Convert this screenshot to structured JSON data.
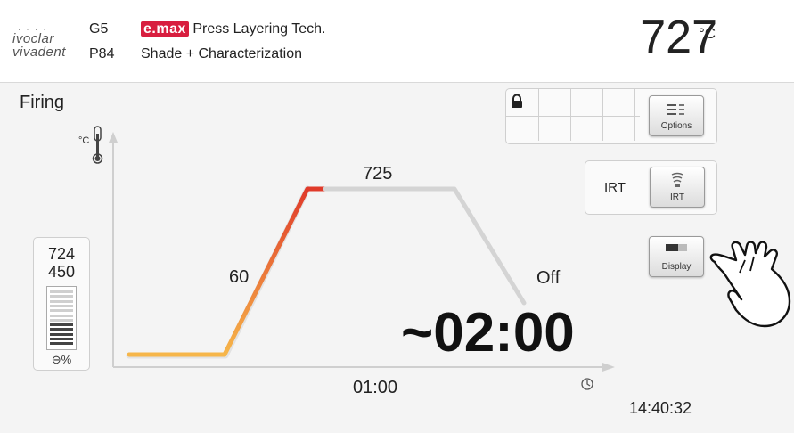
{
  "header": {
    "logo_top": "ivoclar",
    "logo_bottom": "vivadent",
    "program_code": "G5",
    "program_number": "P84",
    "brand": "e.max",
    "product_name": "Press Layering Tech.",
    "subtitle": "Shade + Characterization",
    "temperature": "727",
    "temperature_unit": "°C"
  },
  "main": {
    "title": "Firing",
    "axis_unit": "°C"
  },
  "gauge": {
    "top_value": "724",
    "bottom_value": "450",
    "footer": "%",
    "fill_fraction": 0.45
  },
  "toolbar": {
    "options_label": "Options",
    "irt_caption": "IRT",
    "irt_label": "IRT",
    "display_label": "Display"
  },
  "program_chart": {
    "rate_label": "60",
    "hold_temp_label": "725",
    "end_label": "Off",
    "hold_time_label": "01:00",
    "remaining_time": "~02:00"
  },
  "status": {
    "clock": "14:40:32"
  },
  "icons": {
    "lock": "lock-icon",
    "thermometer": "thermometer-icon",
    "timer": "clock-icon",
    "vacuum": "vacuum-icon",
    "options": "options-icon",
    "irt": "irt-sensor-icon",
    "display": "display-icon",
    "hand": "pointing-hand-icon"
  },
  "colors": {
    "brand": "#d81e3f",
    "heat_low": "#f6b64a",
    "heat_high": "#e03a2a",
    "curve_gray": "#d4d4d4"
  }
}
